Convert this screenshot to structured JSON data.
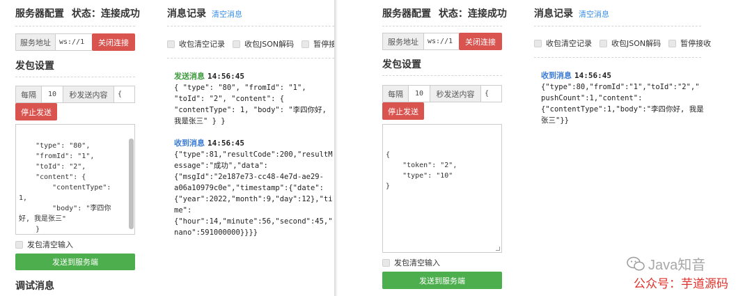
{
  "left": {
    "server": {
      "title": "服务器配置",
      "status": "状态：连接成功",
      "addr_label": "服务地址",
      "addr_value": "ws://1",
      "close_btn": "关闭连接"
    },
    "send": {
      "title": "发包设置",
      "every": "每隔",
      "interval": "10",
      "send_content_label": "秒发送内容",
      "content_prefix": "{",
      "stop_btn": "停止发送",
      "textarea_lines": [
        "    \"type\": \"80\",",
        "    \"fromId\": \"1\",",
        "    \"toId\": \"2\",",
        "    \"content\": {",
        "        \"contentType\":",
        "1,",
        "        \"body\": \"李四你",
        "好, 我是张三\"",
        "    }",
        "}"
      ],
      "clear_input": "发包清空输入",
      "send_btn": "发送到服务端"
    },
    "debug_title": "调试消息",
    "log": {
      "title": "消息记录",
      "clear_link": "清空消息",
      "opts": [
        "收包清空记录",
        "收包JSON解码",
        "暂停接收"
      ],
      "sent": {
        "label": "发送消息",
        "time": "14:56:45",
        "lines": [
          "{ \"type\": \"80\", \"fromId\": \"1\",",
          "\"toId\": \"2\", \"content\": {",
          "\"contentType\": 1, \"body\": \"李四你好,",
          "我是张三\" } }"
        ]
      },
      "recv": {
        "label": "收到消息",
        "time": "14:56:45",
        "lines": [
          "{\"type\":81,\"resultCode\":200,\"resultM",
          "essage\":\"成功\",\"data\":",
          "{\"msgId\":\"2e187e73-cc48-4e7d-ae29-",
          "a06a10979c0e\",\"timestamp\":{\"date\":",
          "{\"year\":2022,\"month\":9,\"day\":12},\"ti",
          "me\":",
          "{\"hour\":14,\"minute\":56,\"second\":45,\"",
          "nano\":591000000}}}}"
        ]
      }
    }
  },
  "right": {
    "server": {
      "title": "服务器配置",
      "status": "状态：连接成功",
      "addr_label": "服务地址",
      "addr_value": "ws://1",
      "close_btn": "关闭连接"
    },
    "send": {
      "title": "发包设置",
      "every": "每隔",
      "interval": "10",
      "send_content_label": "秒发送内容",
      "content_prefix": "{",
      "stop_btn": "停止发送",
      "textarea_lines": [
        "{",
        "    \"token\": \"2\",",
        "    \"type\": \"10\"",
        "}"
      ],
      "clear_input": "发包清空输入",
      "send_btn": "发送到服务端"
    },
    "log": {
      "title": "消息记录",
      "clear_link": "清空消息",
      "opts": [
        "收包清空记录",
        "收包JSON解码",
        "暂停接收"
      ],
      "recv": {
        "label": "收到消息",
        "time": "14:56:45",
        "lines": [
          "{\"type\":80,\"fromId\":\"1\",\"toId\":\"2\",\"",
          "pushCount\":1,\"content\":",
          "{\"contentType\":1,\"body\":\"李四你好, 我是",
          "张三\"}}"
        ]
      }
    },
    "watermark": {
      "brand": "Java知音",
      "account": "公众号：芋道源码"
    }
  },
  "colors": {
    "danger": "#d9534f",
    "success": "#4cae4c",
    "link": "#3a8ee6",
    "sent": "#3c9a3c",
    "recv": "#3a7bd5",
    "watermark": "#e0322b"
  }
}
